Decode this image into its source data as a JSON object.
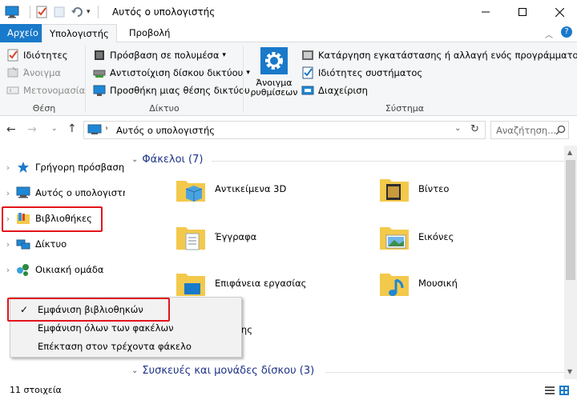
{
  "window": {
    "title": "Αυτός ο υπολογιστής",
    "controls": [
      "minimize",
      "maximize",
      "close"
    ]
  },
  "ribbon_tabs": {
    "file": "Αρχείο",
    "computer": "Υπολογιστής",
    "view": "Προβολή"
  },
  "ribbon": {
    "location": {
      "label": "Θέση",
      "items": [
        "Ιδιότητες",
        "Άνοιγμα",
        "Μετονομασία"
      ]
    },
    "network": {
      "label": "Δίκτυο",
      "items": [
        "Πρόσβαση σε πολυμέσα",
        "Αντιστοίχιση δίσκου δικτύου",
        "Προσθήκη μιας θέσης δικτύου"
      ]
    },
    "system": {
      "label": "Σύστημα",
      "open_settings_line1": "Άνοιγμα",
      "open_settings_line2": "ρυθμίσεων",
      "items": [
        "Κατάργηση εγκατάστασης ή αλλαγή ενός προγράμματος",
        "Ιδιότητες συστήματος",
        "Διαχείριση"
      ]
    }
  },
  "address": {
    "path": "Αυτός ο υπολογιστής",
    "search_placeholder": "Αναζήτηση..."
  },
  "nav": {
    "items": [
      {
        "label": "Γρήγορη πρόσβαση",
        "icon": "star-icon"
      },
      {
        "label": "Αυτός ο υπολογιστής",
        "icon": "computer-icon"
      },
      {
        "label": "Βιβλιοθήκες",
        "icon": "libraries-icon"
      },
      {
        "label": "Δίκτυο",
        "icon": "network-icon"
      },
      {
        "label": "Οικιακή ομάδα",
        "icon": "homegroup-icon"
      }
    ]
  },
  "main": {
    "folders_header": "Φάκελοι (7)",
    "folders": [
      {
        "label": "Αντικείμενα 3D",
        "icon": "objects-3d-folder-icon"
      },
      {
        "label": "Βίντεο",
        "icon": "videos-folder-icon"
      },
      {
        "label": "Έγγραφα",
        "icon": "documents-folder-icon"
      },
      {
        "label": "Εικόνες",
        "icon": "pictures-folder-icon"
      },
      {
        "label": "Επιφάνεια εργασίας",
        "icon": "desktop-folder-icon"
      },
      {
        "label": "Μουσική",
        "icon": "music-folder-icon"
      },
      {
        "label": "α λήψης",
        "icon": "downloads-folder-icon"
      }
    ],
    "devices_header": "Συσκευές και μονάδες δίσκου (3)"
  },
  "context_menu": {
    "items": [
      {
        "label": "Εμφάνιση βιβλιοθηκών",
        "checked": "✓"
      },
      {
        "label": "Εμφάνιση όλων των φακέλων",
        "checked": ""
      },
      {
        "label": "Επέκταση στον τρέχοντα φάκελο",
        "checked": ""
      }
    ]
  },
  "status": {
    "count": "11 στοιχεία"
  },
  "colors": {
    "accent": "#1979ca",
    "highlight_box": "#e3141c",
    "section_header": "#1e3287",
    "selected_nav": "#cce8ff"
  }
}
